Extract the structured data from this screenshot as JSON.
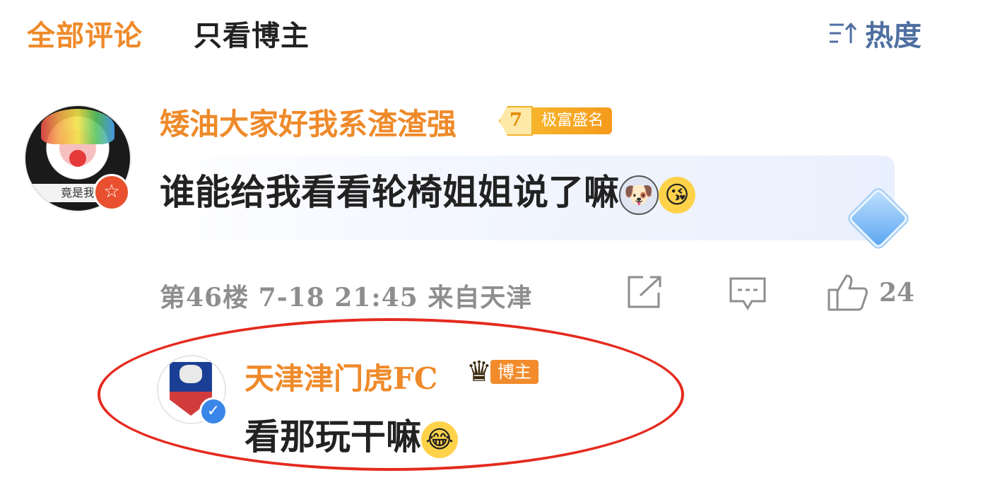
{
  "tabs": {
    "all": "全部评论",
    "op_only": "只看博主"
  },
  "sort": {
    "icon": "sort-lines-up-icon",
    "label": "热度"
  },
  "comment": {
    "username": "矮油大家好我系渣渣强",
    "level": "7",
    "level_title": "极富盛名",
    "avatar_caption": "竟是我",
    "text": "谁能给我看看轮椅姐姐说了嘛",
    "emojis": [
      "dog-emoji",
      "kiss-emoji"
    ],
    "floor": "第46楼",
    "date": "7-18",
    "time": "21:45",
    "location": "来自天津",
    "likes": "24"
  },
  "reply": {
    "username": "天津津门虎FC",
    "badge": "博主",
    "text": "看那玩干嘛",
    "emoji": "laughing-crying-emoji"
  },
  "colors": {
    "accent": "#ef8a2a",
    "highlight_ring": "#e52a1e",
    "meta": "#8e8e8e",
    "sort": "#4e6fa0"
  }
}
